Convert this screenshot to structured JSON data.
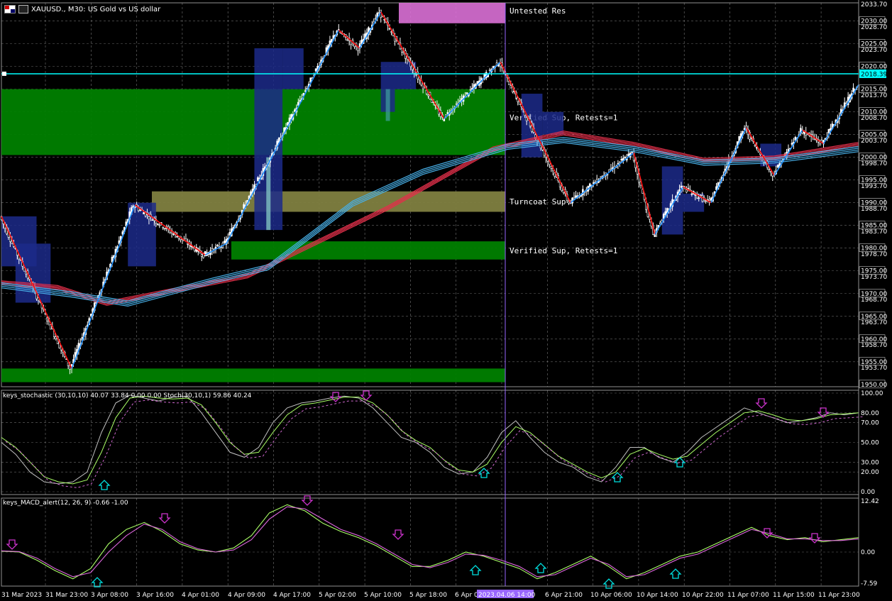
{
  "header": {
    "symbol": "XAUUSD.",
    "timeframe": "M30",
    "description": "US Gold vs US dollar",
    "title": "XAUUSD., M30: US Gold vs US dollar"
  },
  "colors": {
    "background": "#000000",
    "grid": "#c0c0c0",
    "bull": "#ffffff",
    "zone_green": "#008000",
    "zone_olive": "#808040",
    "zone_pink": "#da70d6",
    "bid_line": "#00ffff",
    "ma_red": "#e0304a",
    "ma_blue": "#48b0e8",
    "zigzag_red": "#ff1010",
    "zigzag_blue": "#2090ff",
    "arrow_down": "#cc33cc",
    "arrow_up": "#00e0e0",
    "selection": "#9966ff"
  },
  "zones": [
    {
      "label": "Untested Res",
      "from": 2029.5,
      "to": 2034.0,
      "color": "zone_pink"
    },
    {
      "label": "Verified Sup, Retests=1",
      "from": 2000.5,
      "to": 2015.0,
      "color": "zone_green"
    },
    {
      "label": "Turncoat Sup",
      "from": 1988.0,
      "to": 1992.5,
      "color": "zone_olive"
    },
    {
      "label": "Verified Sup, Retests=1",
      "from": 1977.5,
      "to": 1981.5,
      "color": "zone_green"
    },
    {
      "label": "",
      "from": 1950.5,
      "to": 1953.5,
      "color": "zone_green"
    }
  ],
  "price_axis": {
    "labels": [
      "2033.70",
      "2030.00",
      "2028.70",
      "2025.00",
      "2023.70",
      "2020.00",
      "2015.00",
      "2013.70",
      "2010.00",
      "2008.70",
      "2005.00",
      "2003.70",
      "2000.00",
      "1998.70",
      "1995.00",
      "1993.70",
      "1990.00",
      "1988.70",
      "1985.00",
      "1983.70",
      "1980.00",
      "1978.70",
      "1975.00",
      "1973.70",
      "1970.00",
      "1968.70",
      "1965.00",
      "1963.70",
      "1960.00",
      "1958.70",
      "1955.00",
      "1953.70",
      "1950.00"
    ],
    "current": "2018.39"
  },
  "stoch": {
    "title": "keys_stochastic (30,10,10) 40.07 33.84 0.00 0.00 Stoch(30,10,1) 59.86 40.24",
    "axis": [
      "100.00",
      "80.00",
      "70.00",
      "50.00",
      "30.00",
      "20.00",
      "0.00"
    ]
  },
  "macd": {
    "title": "keys_MACD_alert(12, 26, 9) -0.66 -1.00",
    "axis": [
      "12.42",
      "0.00",
      "-7.59"
    ]
  },
  "time_axis": {
    "labels": [
      "31 Mar 2023",
      "31 Mar 23:00",
      "3 Apr 08:00",
      "3 Apr 16:00",
      "4 Apr 01:00",
      "4 Apr 09:00",
      "4 Apr 17:00",
      "5 Apr 02:00",
      "5 Apr 10:00",
      "5 Apr 18:00",
      "6 Apr 03:00",
      "2023.04.06 14:00",
      "6 Apr 21:00",
      "10 Apr 06:00",
      "10 Apr 14:00",
      "10 Apr 22:00",
      "11 Apr 07:00",
      "11 Apr 15:00",
      "11 Apr 23:00"
    ],
    "highlight": "2023.04.06 14:00"
  },
  "chart_data": [
    {
      "type": "candlestick",
      "title": "XAUUSD., M30: US Gold vs US dollar",
      "ylim": [
        1949.5,
        2034.0
      ],
      "current_price": 2018.39,
      "zigzag": [
        {
          "t": 0,
          "p": 1987
        },
        {
          "t": 10,
          "p": 1953.5
        },
        {
          "t": 19,
          "p": 1989.5
        },
        {
          "t": 29,
          "p": 1978.5
        },
        {
          "t": 32,
          "p": 1981
        },
        {
          "t": 48,
          "p": 2028
        },
        {
          "t": 51,
          "p": 2024
        },
        {
          "t": 54,
          "p": 2032
        },
        {
          "t": 63,
          "p": 2008.5
        },
        {
          "t": 71,
          "p": 2021
        },
        {
          "t": 81,
          "p": 1990
        },
        {
          "t": 90,
          "p": 2001
        },
        {
          "t": 93,
          "p": 1983
        },
        {
          "t": 97,
          "p": 1993.5
        },
        {
          "t": 101,
          "p": 1990
        },
        {
          "t": 106,
          "p": 2006.5
        },
        {
          "t": 110,
          "p": 1996
        },
        {
          "t": 114,
          "p": 2006
        },
        {
          "t": 117,
          "p": 2003
        },
        {
          "t": 122,
          "p": 2016
        }
      ],
      "ma_red": [
        {
          "t": 0,
          "p": 1972.5
        },
        {
          "t": 8,
          "p": 1971.5
        },
        {
          "t": 15,
          "p": 1968
        },
        {
          "t": 25,
          "p": 1971
        },
        {
          "t": 35,
          "p": 1974
        },
        {
          "t": 55,
          "p": 1989
        },
        {
          "t": 70,
          "p": 2002
        },
        {
          "t": 80,
          "p": 2005.5
        },
        {
          "t": 90,
          "p": 2003
        },
        {
          "t": 100,
          "p": 1999.5
        },
        {
          "t": 110,
          "p": 2000
        },
        {
          "t": 122,
          "p": 2003
        }
      ],
      "ma_blue": [
        {
          "t": 0,
          "p": 1972
        },
        {
          "t": 10,
          "p": 1970
        },
        {
          "t": 18,
          "p": 1968
        },
        {
          "t": 30,
          "p": 1973
        },
        {
          "t": 38,
          "p": 1976
        },
        {
          "t": 50,
          "p": 1990
        },
        {
          "t": 60,
          "p": 1997
        },
        {
          "t": 72,
          "p": 2002.5
        },
        {
          "t": 80,
          "p": 2004
        },
        {
          "t": 90,
          "p": 2002
        },
        {
          "t": 100,
          "p": 1999
        },
        {
          "t": 110,
          "p": 1999.5
        },
        {
          "t": 122,
          "p": 2002
        }
      ]
    },
    {
      "type": "line",
      "title": "keys_stochastic (30,10,10) 40.07 33.84 0.00 0.00 Stoch(30,10,1) 59.86 40.24",
      "ylim": [
        0,
        100
      ],
      "series": [
        {
          "name": "",
          "values": [
            50,
            38,
            20,
            10,
            8,
            10,
            20,
            60,
            90,
            98,
            95,
            92,
            96,
            97,
            80,
            60,
            40,
            35,
            45,
            70,
            85,
            90,
            92,
            95,
            97,
            95,
            85,
            70,
            55,
            50,
            40,
            25,
            18,
            20,
            35,
            60,
            72,
            55,
            40,
            30,
            25,
            15,
            10,
            25,
            45,
            45,
            35,
            30,
            40,
            55,
            65,
            75,
            85,
            80,
            75,
            70,
            72,
            75,
            80,
            78,
            80
          ]
        },
        {
          "name": "",
          "values": [
            55,
            45,
            30,
            15,
            10,
            8,
            12,
            40,
            75,
            95,
            97,
            95,
            94,
            95,
            88,
            70,
            50,
            38,
            40,
            60,
            78,
            88,
            90,
            93,
            96,
            96,
            90,
            78,
            62,
            52,
            45,
            32,
            22,
            20,
            28,
            50,
            66,
            60,
            48,
            36,
            28,
            20,
            14,
            20,
            38,
            44,
            38,
            33,
            36,
            48,
            60,
            70,
            80,
            82,
            78,
            73,
            72,
            74,
            78,
            79,
            80
          ]
        }
      ]
    },
    {
      "type": "line",
      "title": "keys_MACD_alert(12, 26, 9) -0.66 -1.00",
      "ylim": [
        -7.59,
        12.42
      ],
      "series": [
        {
          "name": "",
          "values": [
            0.2,
            0,
            -2,
            -4.5,
            -6.5,
            -4,
            2,
            5.5,
            7.2,
            5,
            2,
            0.5,
            0,
            1,
            4,
            9.5,
            11.5,
            10,
            7,
            5,
            3.5,
            1.5,
            -1,
            -3.5,
            -3.5,
            -2,
            0,
            -1,
            -2.5,
            -4,
            -6.5,
            -5,
            -3,
            -1,
            -3.5,
            -6.5,
            -5,
            -3,
            -1,
            0,
            2,
            4,
            6,
            4,
            3,
            3.5,
            2.5,
            3,
            3.5
          ]
        },
        {
          "name": "",
          "values": [
            0.3,
            0.1,
            -1.5,
            -4,
            -6,
            -5,
            0,
            4,
            6.8,
            5.5,
            2.5,
            0.8,
            0,
            0.5,
            3,
            8,
            11,
            10.5,
            8,
            5.5,
            4,
            2,
            -0.5,
            -3,
            -3.8,
            -2.5,
            -0.5,
            -0.8,
            -2,
            -3.5,
            -6,
            -5.5,
            -3.5,
            -1.5,
            -3,
            -6,
            -5.5,
            -3.5,
            -1.5,
            -0.5,
            1.5,
            3.5,
            5.5,
            4.5,
            3.2,
            3.2,
            2.8,
            2.8,
            3.2
          ]
        }
      ]
    }
  ]
}
